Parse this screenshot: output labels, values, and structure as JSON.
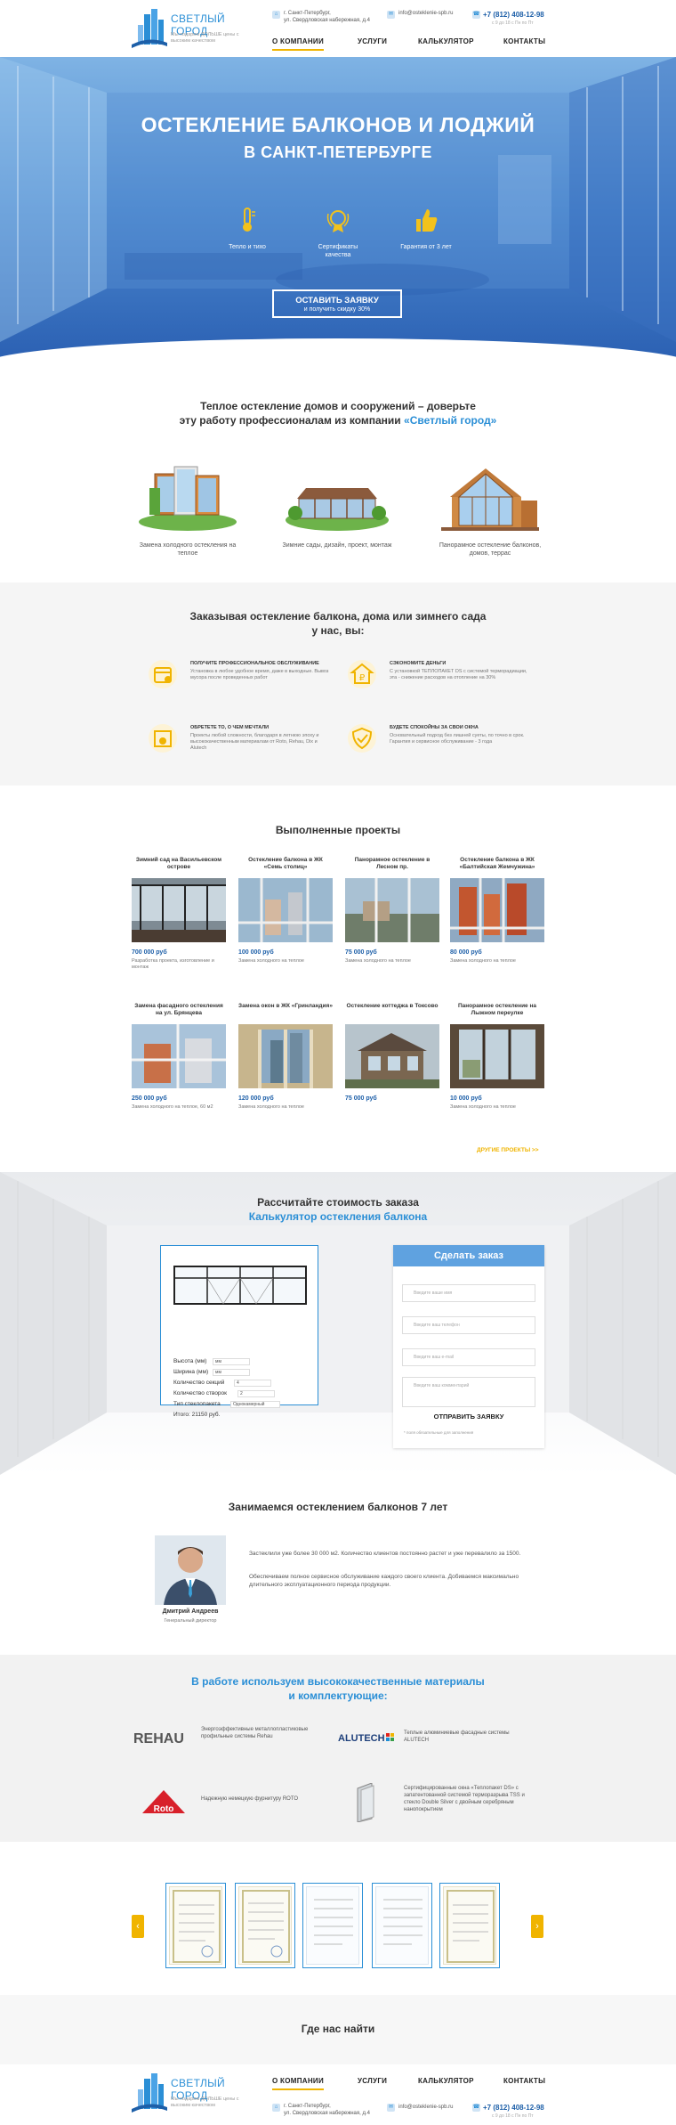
{
  "header": {
    "logo_title": "СВЕТЛЫЙ ГОРОД",
    "logo_tagline": "Мы подарим ДОЛЬШЕ цены с высоким качеством",
    "address_line1": "г. Санкт-Петербург,",
    "address_line2": "ул. Свердловская набережная, д.4",
    "email": "info@osteklenie-spb.ru",
    "phone": "+7 (812) 408-12-98",
    "phone_hours": "с 9 до 18 с Пн по Пт",
    "nav": [
      "О КОМПАНИИ",
      "УСЛУГИ",
      "КАЛЬКУЛЯТОР",
      "КОНТАКТЫ"
    ]
  },
  "hero": {
    "title_line1": "ОСТЕКЛЕНИЕ БАЛКОНОВ И ЛОДЖИЙ",
    "title_line2": "В САНКТ-ПЕТЕРБУРГЕ",
    "features": [
      {
        "icon": "thermometer-icon",
        "label": "Тепло и тихо"
      },
      {
        "icon": "certificate-icon",
        "label": "Сертификаты качества"
      },
      {
        "icon": "thumbs-up-icon",
        "label": "Гарантия от 3 лет"
      }
    ],
    "cta_line1": "ОСТАВИТЬ ЗАЯВКУ",
    "cta_line2": "и получить скидку 30%"
  },
  "warm": {
    "title_line1": "Теплое остекление домов и сооружений – доверьте",
    "title_line2_prefix": "эту работу профессионалам из компании ",
    "title_brand": "«Светлый город»",
    "items": [
      "Замена холодного остекления на теплое",
      "Зимние сады, дизайн, проект, монтаж",
      "Панорамное остекление балконов, домов, террас"
    ]
  },
  "ordering": {
    "title_line1": "Заказывая остекление балкона, дома или зимнего сада",
    "title_line2": "у нас, вы:",
    "benefits": [
      {
        "icon": "calendar-icon",
        "title": "ПОЛУЧИТЕ ПРОФЕССИОНАЛЬНОЕ ОБСЛУЖИВАНИЕ",
        "text": "Установка в любое удобное время, даже в выходные. Вывоз мусора после проведенных работ"
      },
      {
        "icon": "ruble-house-icon",
        "title": "СЭКОНОМИТЕ ДЕНЬГИ",
        "text": "С установкой ТЕПЛОПАКЕТ DS с системой терморадиации, эта - снижение расходов на отопление на 30%"
      },
      {
        "icon": "sun-window-icon",
        "title": "ОБРЕТЕТЕ ТО, О ЧЕМ МЕЧТАЛИ",
        "text": "Проекты любой сложности, благодаря в летнюю эпоху и высококачественным материалам от Roto, Rehau, Dix и Alutech"
      },
      {
        "icon": "shield-check-icon",
        "title": "БУДЕТЕ СПОКОЙНЫ ЗА СВОИ ОКНА",
        "text": "Основательный подход без лишней суеты, по точно в срок. Гарантия и сервисное обслуживание - 3 года"
      }
    ]
  },
  "projects": {
    "title": "Выполненные проекты",
    "items": [
      {
        "name": "Зимний сад на Васильевском острове",
        "price": "700 000 руб",
        "desc": "Разработка проекта, изготовление и монтаж"
      },
      {
        "name": "Остекление балкона в ЖК «Семь столиц»",
        "price": "100 000 руб",
        "desc": "Замена холодного на теплое"
      },
      {
        "name": "Панорамное остекление в Лесном пр.",
        "price": "75 000 руб",
        "desc": "Замена холодного на теплое"
      },
      {
        "name": "Остекление балкона в ЖК «Балтийская Жемчужина»",
        "price": "80 000 руб",
        "desc": "Замена холодного на теплое"
      },
      {
        "name": "Замена фасадного остекления на ул. Брянцева",
        "price": "250 000 руб",
        "desc": "Замена холодного на теплое, 60 м2"
      },
      {
        "name": "Замена окон в ЖК «Гринландия»",
        "price": "120 000 руб",
        "desc": "Замена холодного на теплое"
      },
      {
        "name": "Остекление коттеджа в Токсово",
        "price": "75 000 руб",
        "desc": ""
      },
      {
        "name": "Панорамное остекление на Лыжном переулке",
        "price": "10 000 руб",
        "desc": "Замена холодного на теплое"
      }
    ],
    "more": "ДРУГИЕ ПРОЕКТЫ >>"
  },
  "calculator": {
    "title_line1": "Рассчитайте стоимость заказа",
    "title_line2": "Калькулятор остекления балкона",
    "height_label": "Высота (мм)",
    "height_value": "мм",
    "width_label": "Ширина (мм)",
    "width_value": "мм",
    "sections_label": "Количество секций",
    "sections_value": "4",
    "sashes_label": "Количество створок",
    "sashes_value": "2",
    "unit_label": "Тип стеклопакета",
    "unit_value": "Однокамерный",
    "total_label": "Итого: 21150 руб."
  },
  "order": {
    "title": "Сделать заказ",
    "name_placeholder": "Введите ваше имя",
    "phone_placeholder": "Введите ваш телефон",
    "email_placeholder": "Введите ваш e-mail",
    "comment_placeholder": "Введите ваш комментарий",
    "submit": "ОТПРАВИТЬ ЗАЯВКУ",
    "note": "* поля обязательные для заполнения"
  },
  "about": {
    "title": "Занимаемся остеклением балконов 7 лет",
    "director_name": "Дмитрий Андреев",
    "director_role": "Генеральный директор",
    "text1": "Застеклили уже более 30 000 м2. Количество клиентов постоянно растет и уже перевалило за 1500.",
    "text2": "Обеспечиваем полное сервисное обслуживание каждого своего клиента. Добиваемся максимально длительного эксплуатационного периода продукции."
  },
  "materials": {
    "title_line1": "В работе используем высококачественные материалы",
    "title_line2": "и комплектующие:",
    "items": [
      {
        "brand": "REHAU",
        "text": "Энергоэффективные металлопластиковые профильные системы Rehau"
      },
      {
        "brand": "ALUTECH",
        "text": "Теплые алюминиевые фасадные системы ALUTECH"
      },
      {
        "brand": "Roto",
        "text": "Надежную немецкую фурнитуру ROTO"
      },
      {
        "brand": "glass",
        "text": "Сертифицированные окна «Теплопакет DS» с запатентованной системой терморазрыва TSS и стекло Double Silver с двойным серебряным нанопокрытием"
      }
    ]
  },
  "where": {
    "title": "Где нас найти"
  },
  "colors": {
    "accent": "#2b8fd6",
    "yellow": "#f0b400",
    "navy": "#1d5fa8"
  }
}
